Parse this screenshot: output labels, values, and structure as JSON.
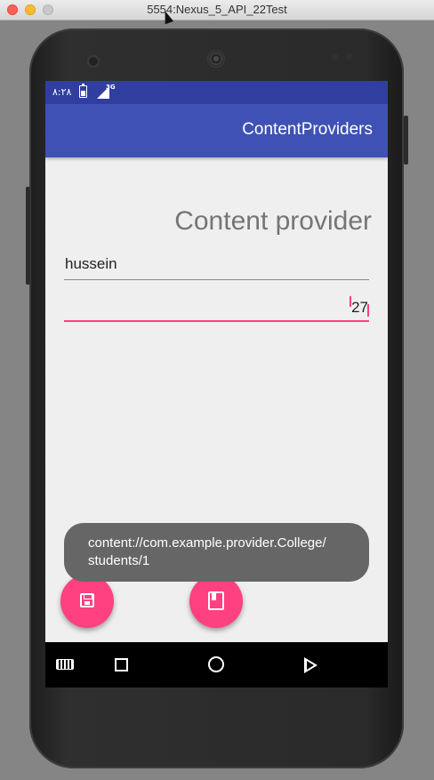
{
  "window": {
    "title": "5554:Nexus_5_API_22Test"
  },
  "statusbar": {
    "time": "٨:٢٨",
    "network": "3G"
  },
  "appbar": {
    "title": "ContentProviders"
  },
  "form": {
    "heading": "Content provider",
    "name_value": "hussein",
    "age_value": "27"
  },
  "toast": {
    "message": "content://com.example.provider.College/ students/1"
  },
  "fabs": {
    "save_icon": "save-icon",
    "book_icon": "book-icon",
    "color": "#ff4081"
  },
  "navbar": {
    "icons": [
      "keyboard-icon",
      "recents-icon",
      "home-icon",
      "back-icon"
    ]
  },
  "colors": {
    "primary": "#3f51b5",
    "primary_dark": "#303f9f",
    "accent": "#ff4081"
  }
}
